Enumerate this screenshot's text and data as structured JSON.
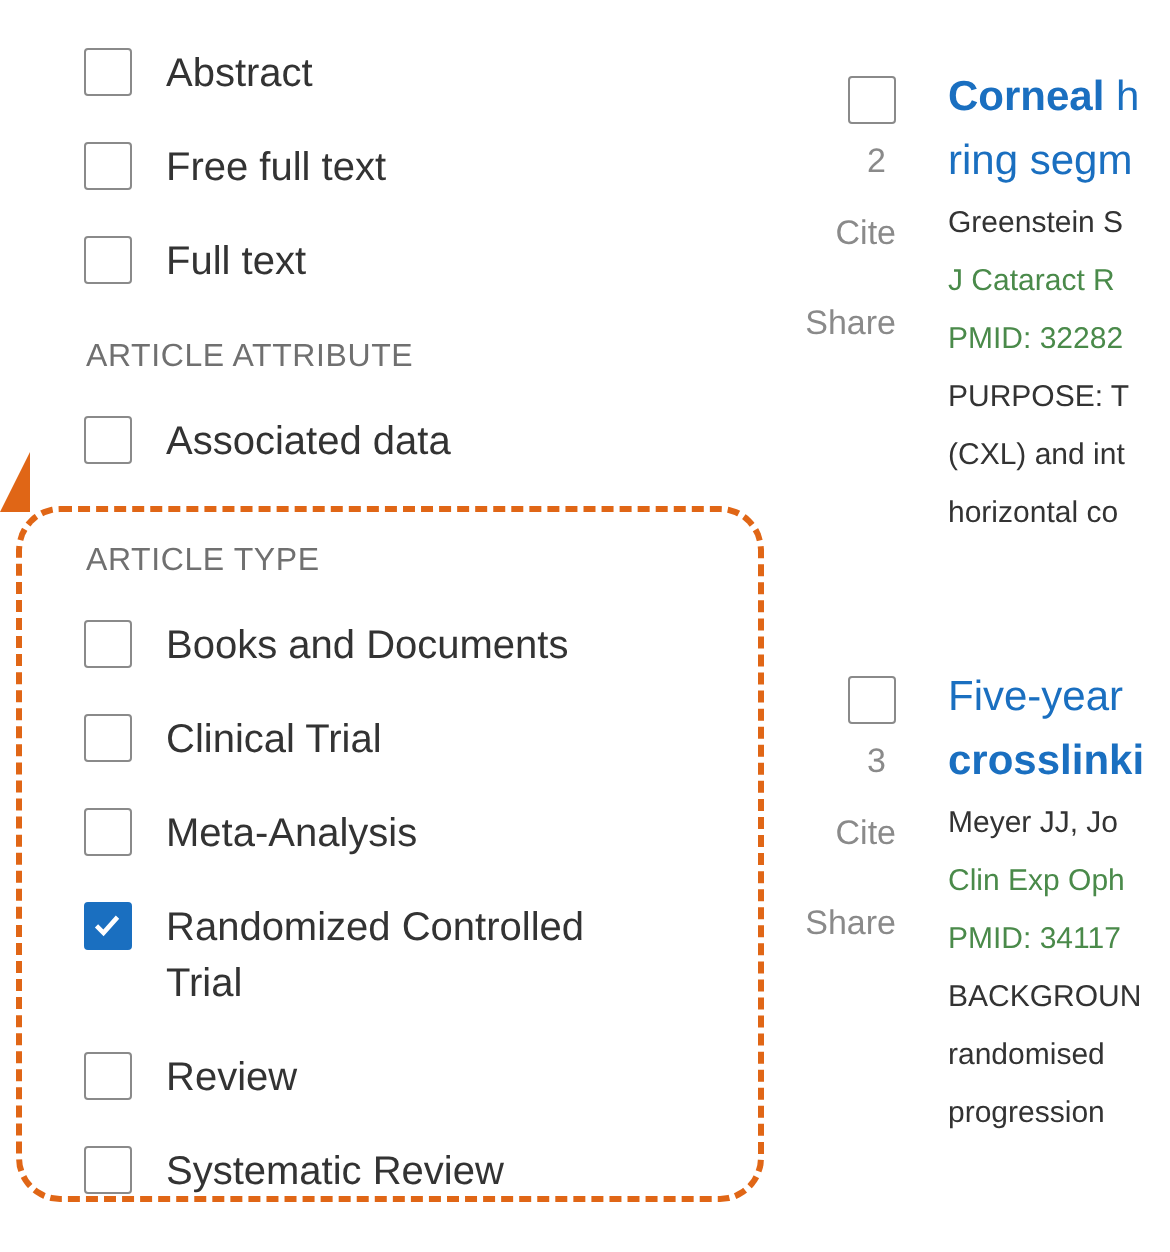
{
  "filter_sections": [
    {
      "items": [
        {
          "label": "Abstract",
          "checked": false
        },
        {
          "label": "Free full text",
          "checked": false
        },
        {
          "label": "Full text",
          "checked": false
        }
      ],
      "highlighted": false
    },
    {
      "heading": "ARTICLE ATTRIBUTE",
      "items": [
        {
          "label": "Associated data",
          "checked": false
        }
      ],
      "highlighted": false
    },
    {
      "heading": "ARTICLE TYPE",
      "items": [
        {
          "label": "Books and Documents",
          "checked": false
        },
        {
          "label": "Clinical Trial",
          "checked": false
        },
        {
          "label": "Meta-Analysis",
          "checked": false
        },
        {
          "label": "Randomized Controlled Trial",
          "checked": true
        },
        {
          "label": "Review",
          "checked": false
        },
        {
          "label": "Systematic Review",
          "checked": false
        }
      ],
      "highlighted": true
    }
  ],
  "results": [
    {
      "number": "2",
      "selected": false,
      "cite": "Cite",
      "share": "Share",
      "title_lines": [
        "**Corneal** h",
        "ring segm"
      ],
      "authors": "Greenstein S",
      "journal": "J Cataract R",
      "pmid": "PMID: 32282",
      "snippet_lines": [
        "PURPOSE: T",
        "(CXL) and int",
        "horizontal co"
      ]
    },
    {
      "number": "3",
      "selected": false,
      "cite": "Cite",
      "share": "Share",
      "title_lines": [
        "Five-year",
        "**crosslinki**"
      ],
      "authors": "Meyer JJ, Jo",
      "journal": "Clin Exp Oph",
      "pmid": "PMID: 34117",
      "snippet_lines": [
        "BACKGROUN",
        "randomised",
        "progression"
      ]
    }
  ]
}
